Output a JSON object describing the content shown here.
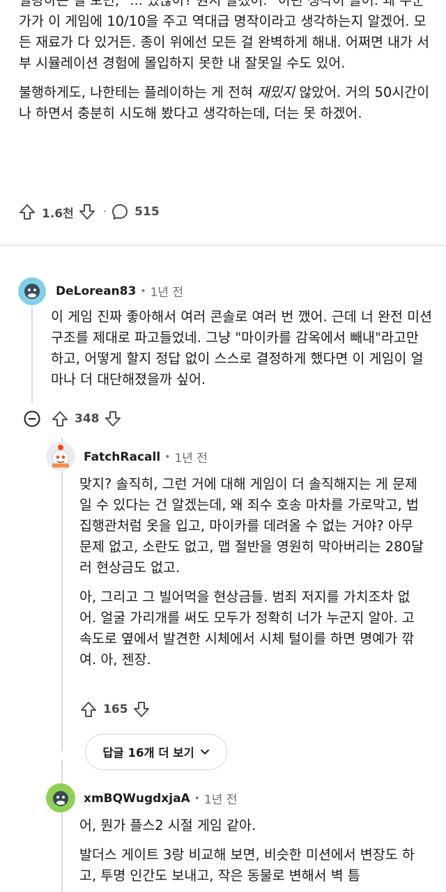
{
  "post": {
    "paragraphs": [
      "열광하는 걸 보면, \"... 있잖아? 뭔지 알겠어.\" 이런 생각이 들어. 왜 누군가가 이 게임에 10/10을 주고 역대급 명작이라고 생각하는지 알겠어. 모든 재료가 다 있거든. 종이 위에선 모든 걸 완벽하게 해내. 어쩌면 내가 서부 시뮬레이션 경험에 몰입하지 못한 내 잘못일 수도 있어."
    ],
    "p2_before": "불행하게도, 나한테는 플레이하는 게 전혀 ",
    "p2_em": "재밌지",
    "p2_after": " 않았어. 거의 50시간이나 하면서 충분히 시도해 봤다고 생각하는데, 더는 못 하겠어.",
    "upvotes": "1.6천",
    "separator": "·",
    "comments": "515"
  },
  "comments": [
    {
      "author": "DeLorean83",
      "dot": "•",
      "time": "1년 전",
      "avatar_color": "#7ecfe8",
      "paragraphs": [
        "이 게임 진짜 좋아해서 여러 콘솔로 여러 번 깼어. 근데 너 완전 미션 구조를 제대로 파고들었네. 그냥 \"마이카를 감옥에서 빼내\"라고만 하고, 어떻게 할지 정답 없이 스스로 결정하게 했다면 이 게임이 얼마나 더 대단해졌을까 싶어."
      ],
      "votes": "348"
    },
    {
      "author": "FatchRacall",
      "dot": "•",
      "time": "1년 전",
      "avatar_color": "#e8edf2",
      "paragraphs": [
        "맞지? 솔직히, 그런 거에 대해 게임이 더 솔직해지는 게 문제일 수 있다는 건 알겠는데, 왜 죄수 호송 마차를 가로막고, 법 집행관처럼 옷을 입고, 마이카를 데려올 수 없는 거야? 아무 문제 없고, 소란도 없고, 맵 절반을 영원히 막아버리는 280달러 현상금도 없고.",
        "아, 그리고 그 빌어먹을 현상금들. 범죄 저지를 가치조차 없어. 얼굴 가리개를 써도 모두가 정확히 너가 누군지 알아. 고속도로 옆에서 발견한 시체에서 시체 털이를 하면 명예가 깎여. 아, 젠장."
      ],
      "votes": "165"
    },
    {
      "author": "xmBQWugdxjaA",
      "dot": "•",
      "time": "1년 전",
      "avatar_color": "#8fd14f",
      "paragraphs": [
        "어, 뭔가 플스2 시절 게임 같아.",
        "발더스 게이트 3랑 비교해 보면, 비슷한 미션에서 변장도 하고, 투명 인간도 보내고, 작은 동물로 변해서 벽 틈"
      ]
    }
  ],
  "more_replies_label": "답글 16개 더 보기",
  "icons": {
    "upvote": "upvote-arrow-icon",
    "downvote": "downvote-arrow-icon",
    "comment": "comment-bubble-icon",
    "collapse": "collapse-minus-icon",
    "chevron": "chevron-down-icon"
  }
}
